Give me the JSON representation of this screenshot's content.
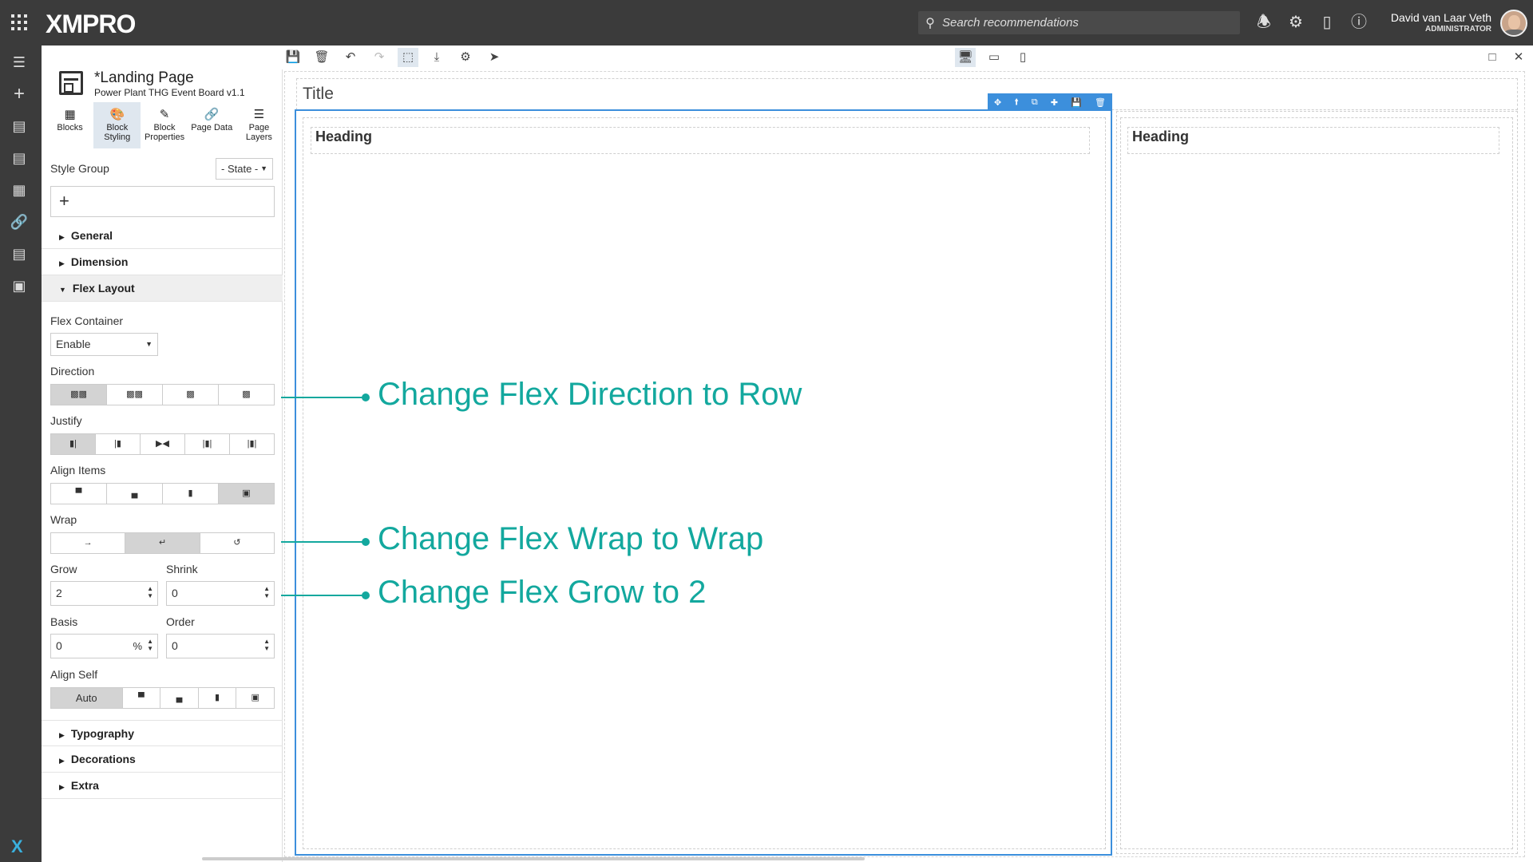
{
  "app": {
    "logo": "XMPRO",
    "search_placeholder": "Search recommendations",
    "user_name": "David van Laar Veth",
    "user_role": "ADMINISTRATOR"
  },
  "page": {
    "title": "*Landing Page",
    "subtitle": "Power Plant THG Event Board v1.1"
  },
  "panel_tabs": [
    {
      "label": "Blocks",
      "icon": "grid-icon"
    },
    {
      "label": "Block Styling",
      "icon": "palette-icon"
    },
    {
      "label": "Block Properties",
      "icon": "pencil-icon"
    },
    {
      "label": "Page Data",
      "icon": "link-icon"
    },
    {
      "label": "Page Layers",
      "icon": "layers-icon"
    }
  ],
  "style_group": {
    "label": "Style Group",
    "state": "- State -",
    "add": "+"
  },
  "sections": {
    "general": "General",
    "dimension": "Dimension",
    "flex_layout": "Flex Layout",
    "typography": "Typography",
    "decorations": "Decorations",
    "extra": "Extra"
  },
  "flex": {
    "container_label": "Flex Container",
    "container_value": "Enable",
    "direction_label": "Direction",
    "justify_label": "Justify",
    "align_items_label": "Align Items",
    "wrap_label": "Wrap",
    "grow_label": "Grow",
    "grow_value": "2",
    "shrink_label": "Shrink",
    "shrink_value": "0",
    "basis_label": "Basis",
    "basis_value": "0",
    "basis_unit": "%",
    "order_label": "Order",
    "order_value": "0",
    "align_self_label": "Align Self",
    "align_self_value": "Auto"
  },
  "canvas": {
    "title": "Title",
    "heading_left": "Heading",
    "heading_right": "Heading"
  },
  "annotations": {
    "direction": "Change Flex Direction to Row",
    "wrap": "Change Flex Wrap to Wrap",
    "grow": "Change Flex Grow to 2"
  },
  "colors": {
    "topbar": "#3b3b3b",
    "selection": "#3c8fdc",
    "annotation": "#13a89e",
    "active_tab": "#dfe7ef"
  }
}
